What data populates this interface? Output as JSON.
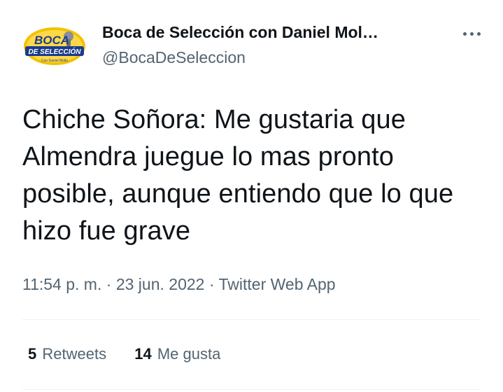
{
  "author": {
    "display_name": "Boca de Selección con Daniel Mol…",
    "handle": "@BocaDeSeleccion",
    "avatar_icon": "boca-de-seleccion-logo",
    "logo_text_top": "BOCA",
    "logo_text_mid": "DE SELECCIÓN",
    "logo_text_small": "Con Daniel Mollo"
  },
  "more_icon": "more-horizontal-icon",
  "tweet": {
    "text": "Chiche Soñora: Me gustaria que Almendra juegue lo mas pronto posible, aunque entiendo que lo que hizo fue grave"
  },
  "meta": {
    "time": "11:54 p. m.",
    "sep1": "·",
    "date": "23 jun. 2022",
    "sep2": "·",
    "source": "Twitter Web App"
  },
  "stats": {
    "retweets_count": "5",
    "retweets_label": "Retweets",
    "likes_count": "14",
    "likes_label": "Me gusta"
  },
  "colors": {
    "text_primary": "#0f1419",
    "text_secondary": "#536471",
    "divider": "#eff3f4",
    "logo_yellow": "#f2c200",
    "logo_blue": "#1a3c8c"
  }
}
